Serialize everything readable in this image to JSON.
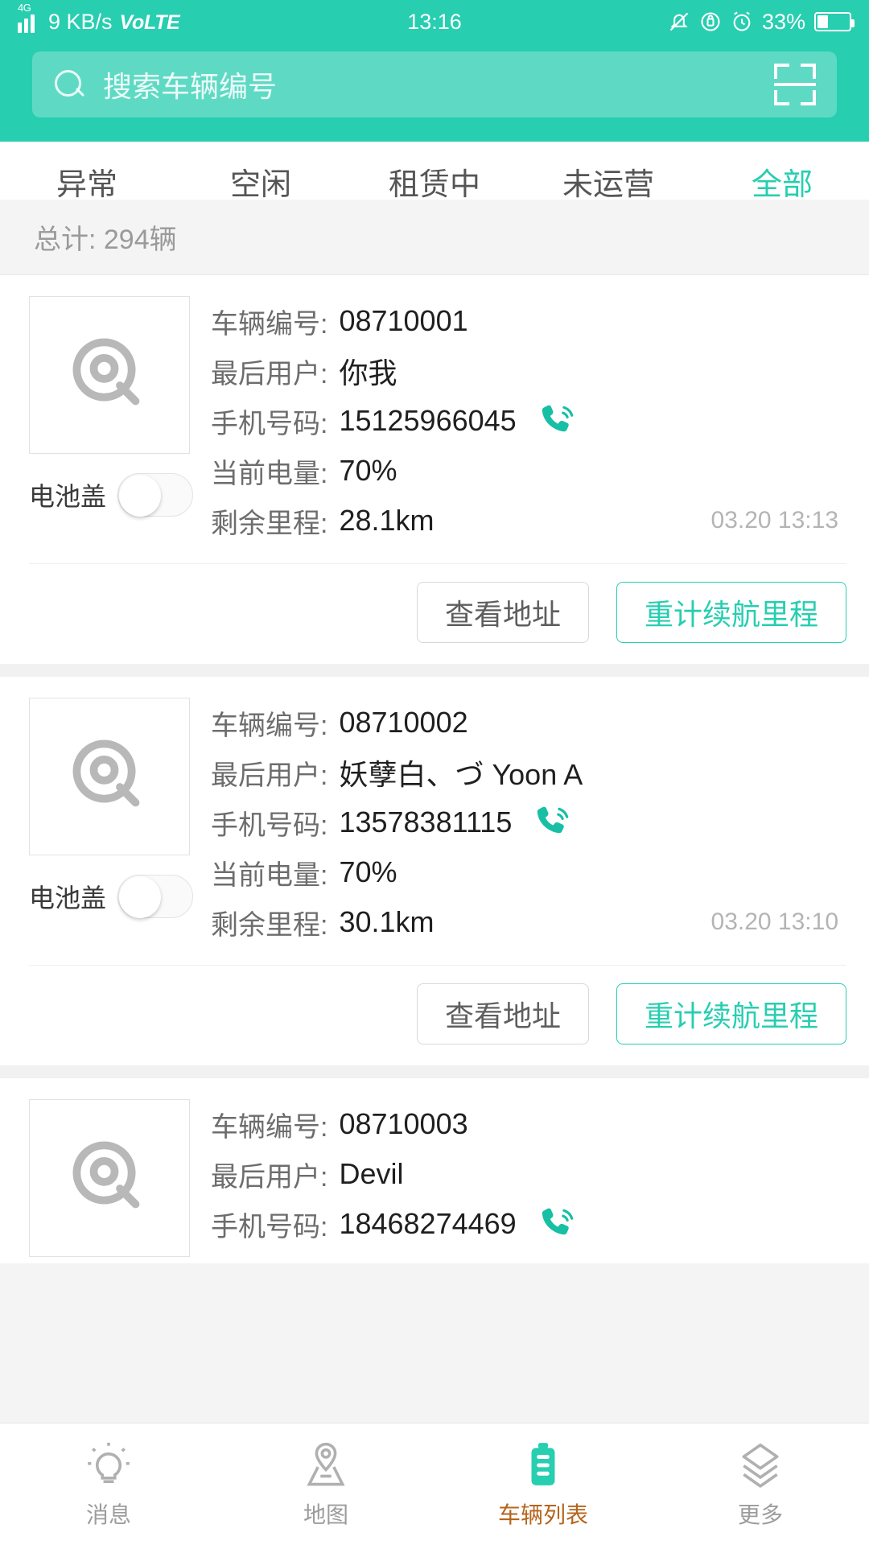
{
  "status_bar": {
    "network_type": "4G",
    "speed": "9 KB/s",
    "volte": "VoLTE",
    "time": "13:16",
    "battery_percent": "33%",
    "icons": [
      "signal-icon",
      "mute-icon",
      "lock-icon",
      "alarm-icon",
      "battery-icon"
    ]
  },
  "search": {
    "placeholder": "搜索车辆编号",
    "search_icon": "search-icon",
    "scan_icon": "scan-qr-icon"
  },
  "tabs": [
    {
      "label": "异常",
      "active": false
    },
    {
      "label": "空闲",
      "active": false
    },
    {
      "label": "租赁中",
      "active": false
    },
    {
      "label": "未运营",
      "active": false
    },
    {
      "label": "全部",
      "active": true
    }
  ],
  "summary": {
    "total_text": "总计: 294辆"
  },
  "labels": {
    "vehicle_no": "车辆编号:",
    "last_user": "最后用户:",
    "phone": "手机号码:",
    "battery": "当前电量:",
    "range": "剩余里程:",
    "battery_cover": "电池盖"
  },
  "buttons": {
    "view_address": "查看地址",
    "recalc_range": "重计续航里程"
  },
  "cards": [
    {
      "vehicle_no": "08710001",
      "last_user": "你我",
      "phone": "15125966045",
      "battery": "70%",
      "range": "28.1km",
      "timestamp": "03.20 13:13",
      "cover_on": false
    },
    {
      "vehicle_no": "08710002",
      "last_user": "妖孽白、づ Yoon A",
      "phone": "13578381115",
      "battery": "70%",
      "range": "30.1km",
      "timestamp": "03.20 13:10",
      "cover_on": false
    },
    {
      "vehicle_no": "08710003",
      "last_user": "Devil",
      "phone": "18468274469",
      "battery": "",
      "range": "",
      "timestamp": "",
      "cover_on": false
    }
  ],
  "bottom_nav": [
    {
      "label": "消息",
      "icon": "lightbulb-icon",
      "active": false
    },
    {
      "label": "地图",
      "icon": "map-pin-icon",
      "active": false
    },
    {
      "label": "车辆列表",
      "icon": "battery-list-icon",
      "active": true
    },
    {
      "label": "更多",
      "icon": "layers-icon",
      "active": false
    }
  ],
  "colors": {
    "accent": "#27ceb0",
    "active_nav_text": "#b5651d",
    "muted_text": "#9a9a9a"
  }
}
